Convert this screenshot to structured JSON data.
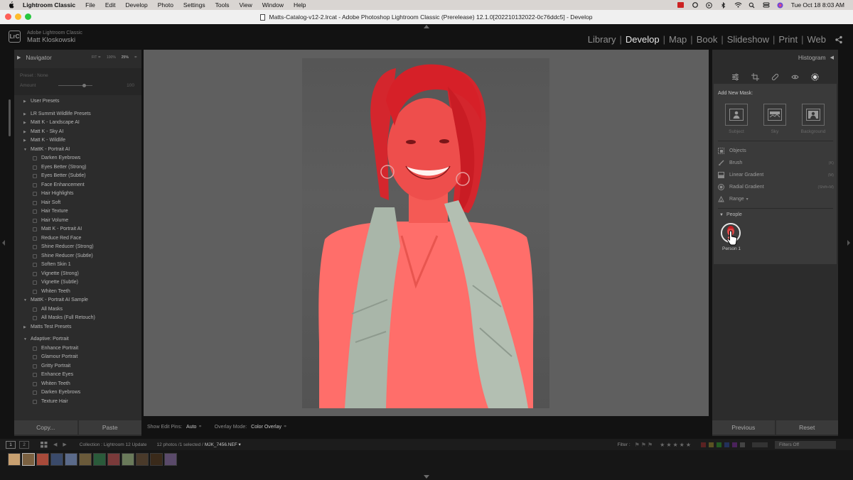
{
  "menubar": {
    "app_name": "Lightroom Classic",
    "items": [
      "File",
      "Edit",
      "Develop",
      "Photo",
      "Settings",
      "Tools",
      "View",
      "Window",
      "Help"
    ],
    "datetime": "Tue Oct 18  8:03 AM"
  },
  "window": {
    "title": "Matts-Catalog-v12-2.lrcat - Adobe Photoshop Lightroom Classic (Prerelease) 12.1.0[202210132022-0c76ddc5] - Develop"
  },
  "identity": {
    "logo": "LrC",
    "product": "Adobe Lightroom Classic",
    "user": "Matt Kloskowski"
  },
  "modules": [
    "Library",
    "Develop",
    "Map",
    "Book",
    "Slideshow",
    "Print",
    "Web"
  ],
  "active_module": "Develop",
  "navigator": {
    "title": "Navigator",
    "zoom_options": [
      "FIT ≑",
      "100%",
      "25%",
      "≑"
    ],
    "selected_zoom": "25%"
  },
  "preset_header": {
    "label": "Preset : None",
    "amount_label": "Amount",
    "amount_value": "100"
  },
  "presets": [
    {
      "type": "folder",
      "label": "User Presets",
      "open": false
    },
    {
      "type": "folder",
      "label": "LR Summit Wildlife Presets",
      "open": false,
      "gap": true
    },
    {
      "type": "folder",
      "label": "Matt K - Landscape AI",
      "open": false
    },
    {
      "type": "folder",
      "label": "Matt K - Sky AI",
      "open": false
    },
    {
      "type": "folder",
      "label": "Matt K - Wildlife",
      "open": false
    },
    {
      "type": "folder",
      "label": "MattK - Portrait AI",
      "open": true
    },
    {
      "type": "item",
      "label": "Darken Eyebrows"
    },
    {
      "type": "item",
      "label": "Eyes Better (Strong)"
    },
    {
      "type": "item",
      "label": "Eyes Better (Subtle)"
    },
    {
      "type": "item",
      "label": "Face Enhancement"
    },
    {
      "type": "item",
      "label": "Hair Highlights"
    },
    {
      "type": "item",
      "label": "Hair Soft"
    },
    {
      "type": "item",
      "label": "Hair Texture"
    },
    {
      "type": "item",
      "label": "Hair Volume"
    },
    {
      "type": "item",
      "label": "Matt K - Portrait AI"
    },
    {
      "type": "item",
      "label": "Reduce Red Face"
    },
    {
      "type": "item",
      "label": "Shine Reducer (Strong)"
    },
    {
      "type": "item",
      "label": "Shine Reducer (Subtle)"
    },
    {
      "type": "item",
      "label": "Soften Skin 1"
    },
    {
      "type": "item",
      "label": "Vignette (Strong)"
    },
    {
      "type": "item",
      "label": "Vignette (Subtle)"
    },
    {
      "type": "item",
      "label": "Whiten Teeth"
    },
    {
      "type": "folder",
      "label": "MattK - Portrait AI Sample",
      "open": true
    },
    {
      "type": "item",
      "label": "All Masks"
    },
    {
      "type": "item",
      "label": "All Masks (Full Retouch)"
    },
    {
      "type": "folder",
      "label": "Matts Test Presets",
      "open": false
    },
    {
      "type": "folder",
      "label": "Adaptive: Portrait",
      "open": true,
      "gap": true
    },
    {
      "type": "item",
      "label": "Enhance Portrait"
    },
    {
      "type": "item",
      "label": "Glamour Portrait"
    },
    {
      "type": "item",
      "label": "Gritty Portrait"
    },
    {
      "type": "item",
      "label": "Enhance Eyes"
    },
    {
      "type": "item",
      "label": "Whiten Teeth"
    },
    {
      "type": "item",
      "label": "Darken Eyebrows"
    },
    {
      "type": "item",
      "label": "Texture Hair"
    }
  ],
  "left_buttons": {
    "copy": "Copy...",
    "paste": "Paste"
  },
  "toolbar": {
    "edit_pins_label": "Show Edit Pins:",
    "edit_pins_value": "Auto",
    "overlay_label": "Overlay Mode:",
    "overlay_value": "Color Overlay",
    "chevron": "≑"
  },
  "histogram": {
    "title": "Histogram"
  },
  "mask_panel": {
    "add_label": "Add New Mask:",
    "big_options": [
      "Subject",
      "Sky",
      "Background"
    ],
    "tools": [
      {
        "label": "Objects",
        "shortcut": ""
      },
      {
        "label": "Brush",
        "shortcut": "(K)"
      },
      {
        "label": "Linear Gradient",
        "shortcut": "(M)"
      },
      {
        "label": "Radial Gradient",
        "shortcut": "(Shift+M)"
      },
      {
        "label": "Range",
        "shortcut": ""
      }
    ],
    "range_chevron": "▾",
    "people_label": "People",
    "person_label": "Person 1"
  },
  "right_buttons": {
    "previous": "Previous",
    "reset": "Reset"
  },
  "filmstrip": {
    "page1": "1",
    "page2": "2",
    "collection": "Collection : Lightroom 12 Update",
    "count": "12 photos /1 selected /",
    "filename": "MJK_7456.NEF ▾",
    "filter_label": "Filter :",
    "filters_off": "Filters Off",
    "stars": "★★★★★",
    "thumb_count": 12,
    "selected_index": 1
  },
  "colors": {
    "accent_active": "#e8e8e8",
    "mask_overlay": "#e0282e",
    "skin_overlay": "#ff6e6a",
    "scarf": "#a9b6a9"
  }
}
